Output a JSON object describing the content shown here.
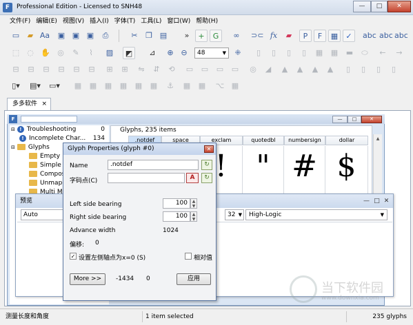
{
  "window": {
    "title": "Professional Edition - Licensed to SNH48",
    "app_icon": "F",
    "min": "—",
    "max": "□",
    "close": "✕"
  },
  "menu": [
    "文件(F)",
    "编辑(E)",
    "视图(V)",
    "插入(I)",
    "字体(T)",
    "工具(L)",
    "窗口(W)",
    "帮助(H)"
  ],
  "toolbar": {
    "zoom_value": "48"
  },
  "tabs": [
    {
      "label": "多多软件",
      "close": "×"
    }
  ],
  "tree": [
    {
      "label": "Troubleshooting",
      "count": "0",
      "icon": "info-icon"
    },
    {
      "label": "Incomplete Char...",
      "count": "134",
      "icon": "info-icon"
    },
    {
      "label": "Glyphs",
      "count": "",
      "icon": "folder-icon"
    },
    {
      "label": "Empty",
      "count": "",
      "icon": "folder-icon"
    },
    {
      "label": "Simple",
      "count": "",
      "icon": "folder-icon"
    },
    {
      "label": "Compos",
      "count": "",
      "icon": "folder-icon"
    },
    {
      "label": "Unmapp",
      "count": "",
      "icon": "folder-icon"
    },
    {
      "label": "Multi M",
      "count": "",
      "icon": "folder-icon"
    }
  ],
  "glyph_panel": {
    "title": "Glyphs, 235 items",
    "columns": [
      ".notdef",
      "space",
      "exclam",
      "quotedbl",
      "numbersign",
      "dollar"
    ],
    "glyphs": [
      "",
      "",
      "!",
      "\"",
      "#",
      "$"
    ]
  },
  "preview": {
    "title": "预览",
    "mode": "Auto",
    "size": "32",
    "render": "High-Logic"
  },
  "dialog": {
    "title": "Glyph Properties (glyph #0)",
    "name_label": "Name",
    "name_value": ".notdef",
    "codepoint_label": "字码点(C)",
    "codepoint_value": "",
    "lsb_label": "Left side bearing",
    "lsb_value": "100",
    "rsb_label": "Right side bearing",
    "rsb_value": "100",
    "advance_label": "Advance width",
    "advance_value": "1024",
    "offset_label": "偏移:",
    "offset_value": "0",
    "origin_checkbox": "设置左侧轴点为x=0 (S)",
    "relative_checkbox": "相对值",
    "more_button": "More >>",
    "coord_x": "-1434",
    "coord_y": "0",
    "apply_button": "应用"
  },
  "status": {
    "left": "测量长度和角度",
    "middle": "1 item selected",
    "right": "235 glyphs"
  },
  "watermark": {
    "text": "当下软件园",
    "url": "www.downxia.com"
  }
}
